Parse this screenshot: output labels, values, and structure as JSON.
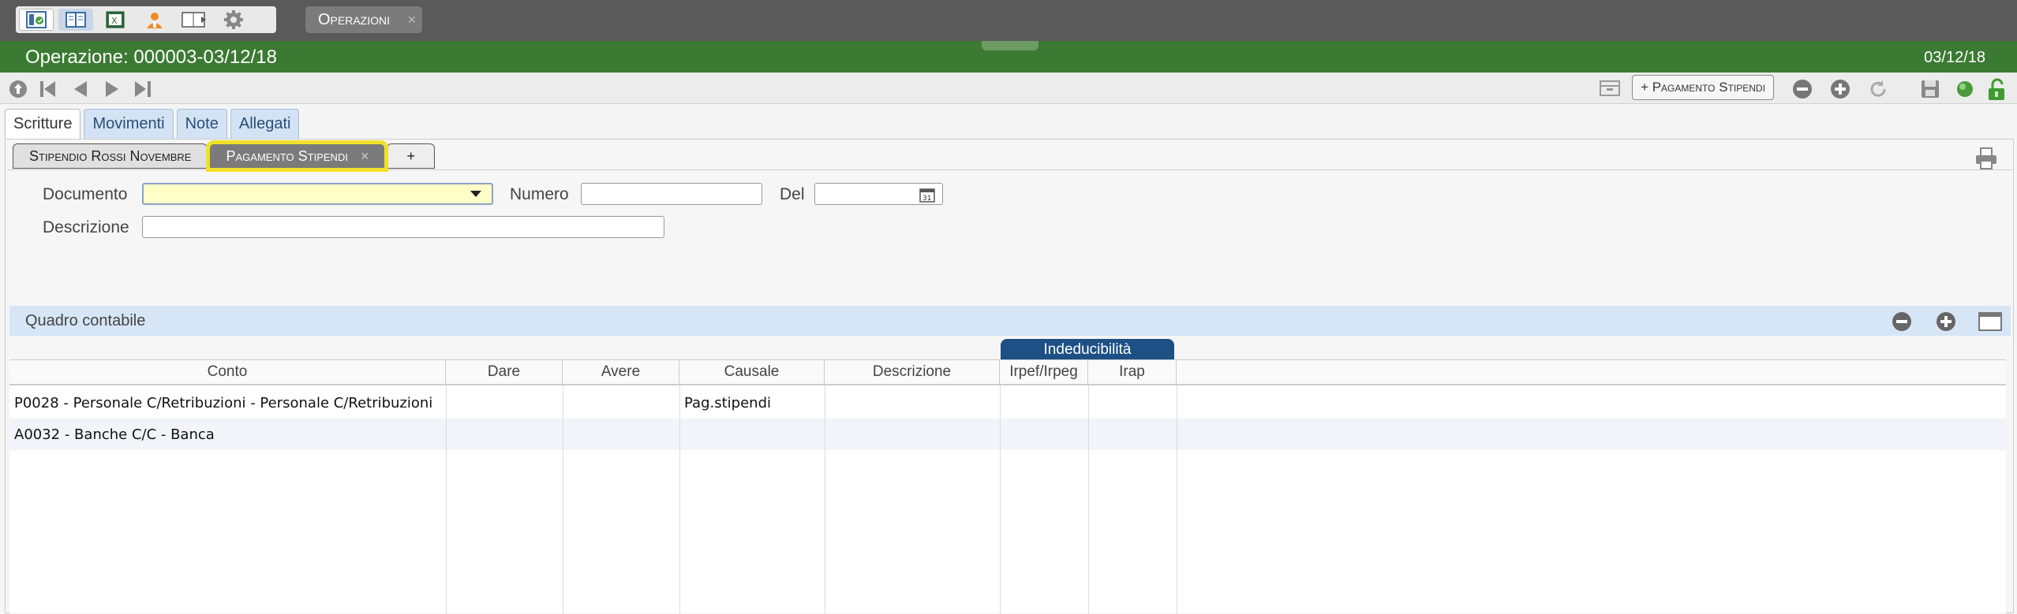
{
  "top": {
    "tab_label": "Operazioni",
    "tab_close": "×",
    "icons": [
      "module-icon",
      "list-icon",
      "spreadsheet-icon",
      "user-icon",
      "document-icon",
      "settings-icon"
    ]
  },
  "header": {
    "title": "Operazione: 000003-03/12/18",
    "date": "03/12/18",
    "accent": "#3b7a32"
  },
  "toolbar": {
    "pay_button": "+ Pagamento Stipendi"
  },
  "tabs": [
    "Scritture",
    "Movimenti",
    "Note",
    "Allegati"
  ],
  "subtabs": {
    "items": [
      "Stipendio Rossi Novembre",
      "Pagamento Stipendi"
    ],
    "close": "×",
    "add": "+"
  },
  "form": {
    "documento_label": "Documento",
    "documento_value": "",
    "numero_label": "Numero",
    "numero_value": "",
    "del_label": "Del",
    "del_value": "",
    "descrizione_label": "Descrizione",
    "descrizione_value": ""
  },
  "quadro": {
    "title": "Quadro contabile",
    "group_header": "Indeducibilità",
    "columns": [
      "Conto",
      "Dare",
      "Avere",
      "Causale",
      "Descrizione",
      "Irpef/Irpeg",
      "Irap"
    ],
    "rows": [
      {
        "conto": "P0028 - Personale C/Retribuzioni - Personale C/Retribuzioni",
        "dare": "",
        "avere": "",
        "causale": "Pag.stipendi",
        "descrizione": "",
        "irpef": "",
        "irap": ""
      },
      {
        "conto": "A0032 - Banche C/C - Banca",
        "dare": "",
        "avere": "",
        "causale": "",
        "descrizione": "",
        "irpef": "",
        "irap": ""
      }
    ]
  }
}
